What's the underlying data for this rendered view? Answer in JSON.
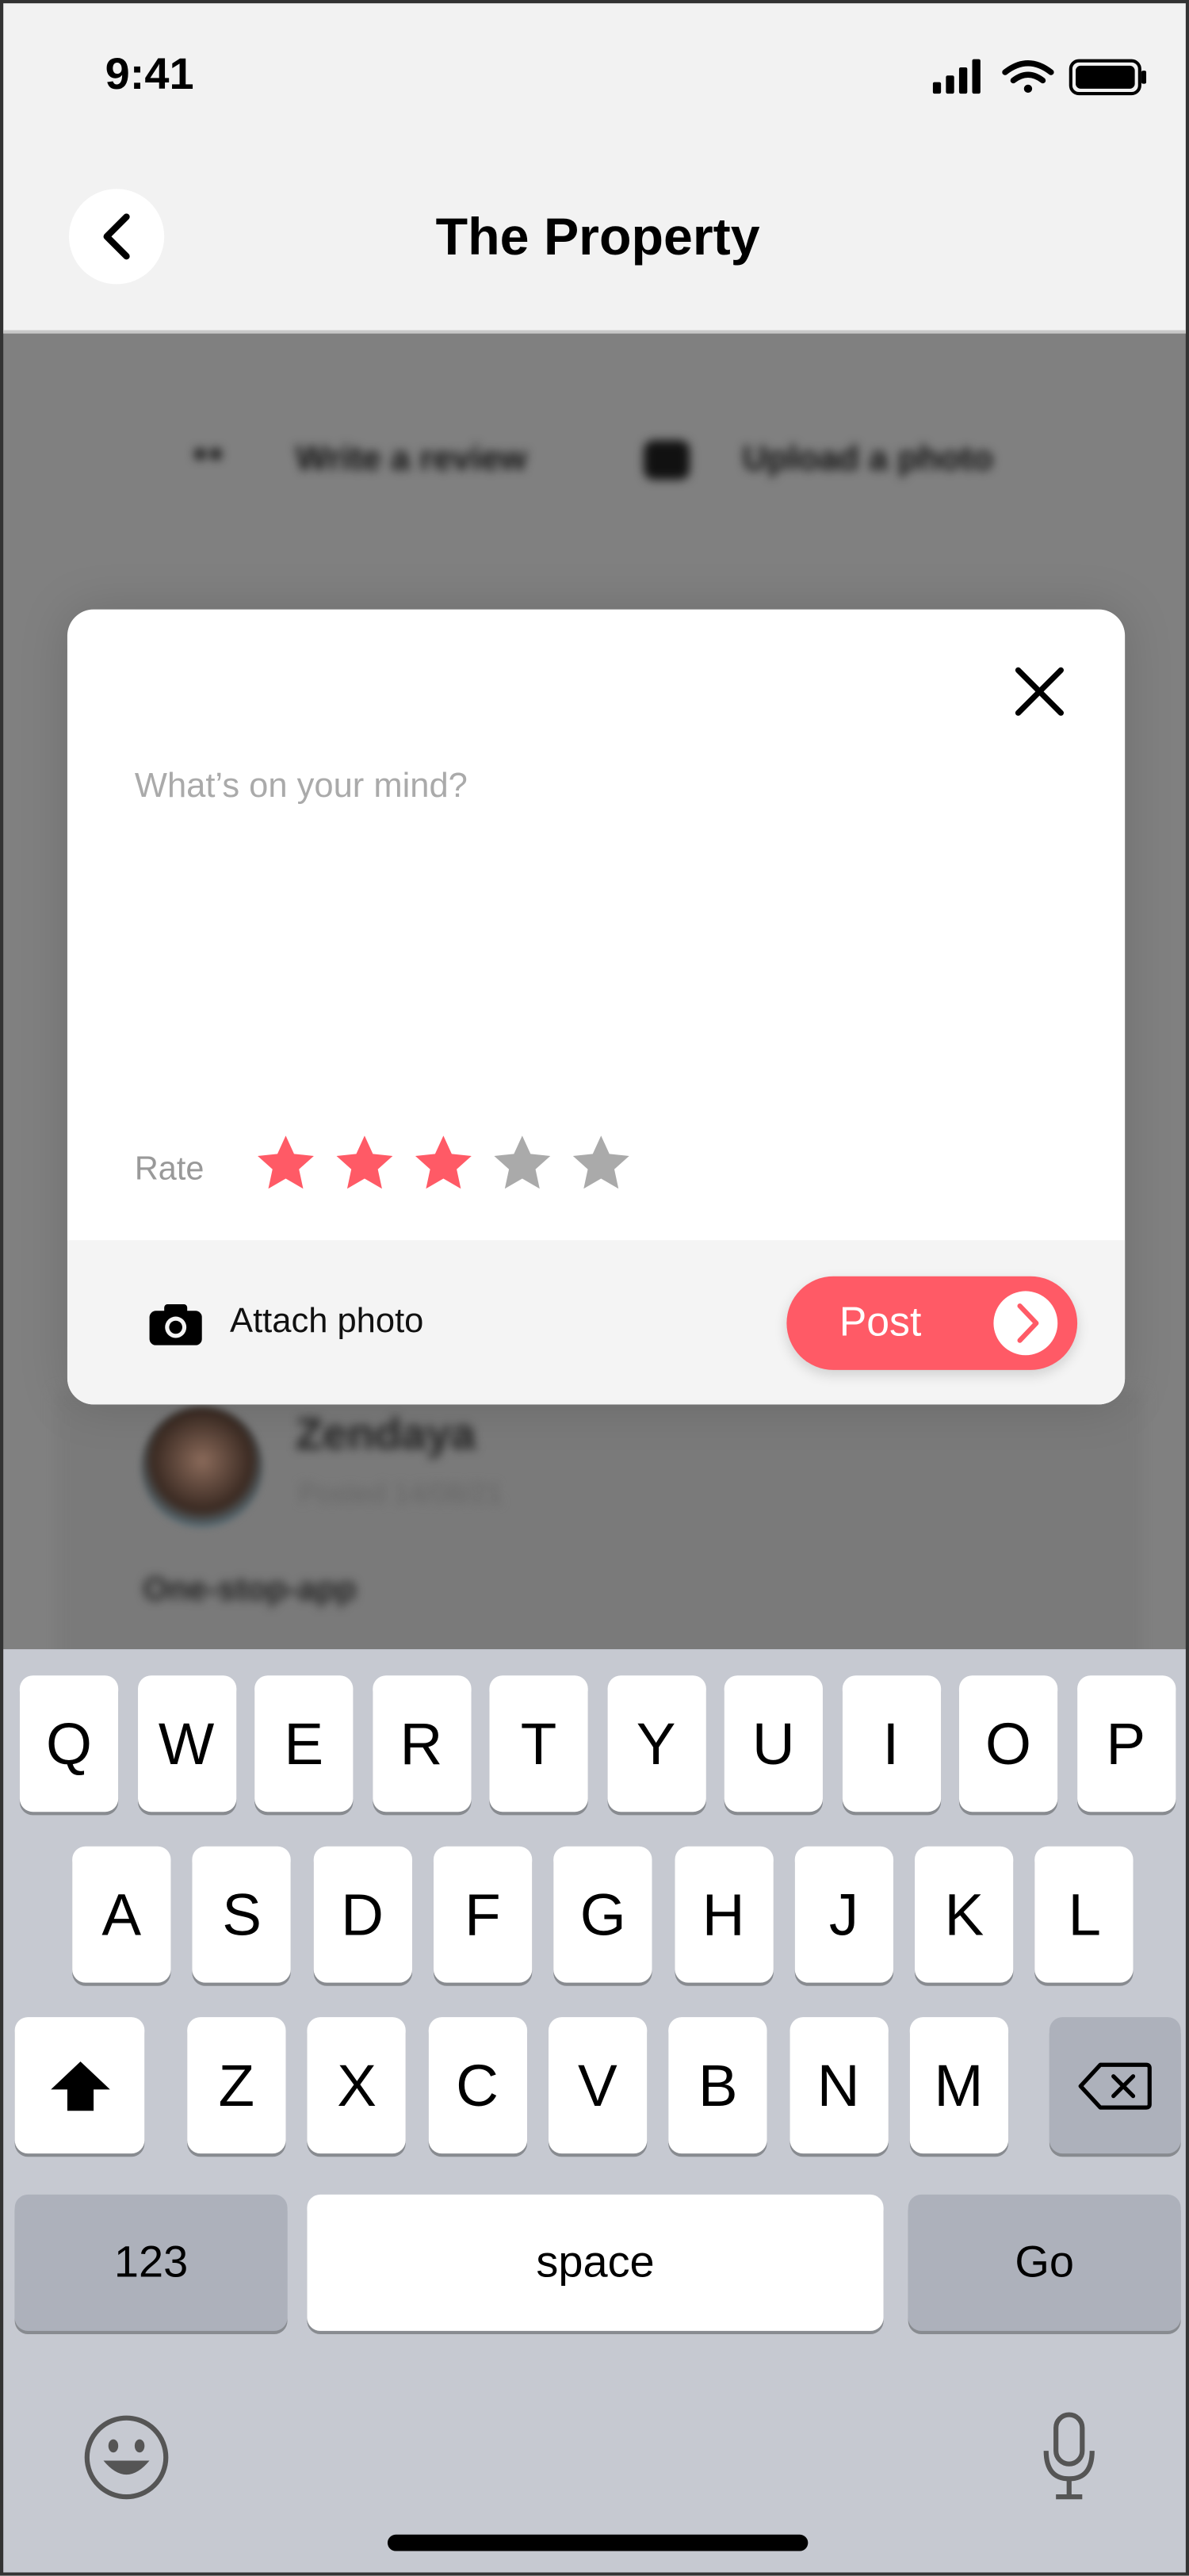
{
  "status_bar": {
    "time": "9:41"
  },
  "header": {
    "title": "The Property",
    "back_icon": "chevron-left-icon"
  },
  "background": {
    "write_review": "Write a review",
    "upload_photo": "Upload a photo",
    "review": {
      "author": "Zendaya",
      "posted": "Posted 14/08/21",
      "text": "One-stop-app"
    }
  },
  "modal": {
    "placeholder": "What’s on your mind?",
    "rate_label": "Rate",
    "rating": 3,
    "max_rating": 5,
    "attach_label": "Attach photo",
    "post_label": "Post",
    "accent": "#ff5a66",
    "star_off": "#aaaaaa"
  },
  "keyboard": {
    "row1": [
      "Q",
      "W",
      "E",
      "R",
      "T",
      "Y",
      "U",
      "I",
      "O",
      "P"
    ],
    "row2": [
      "A",
      "S",
      "D",
      "F",
      "G",
      "H",
      "J",
      "K",
      "L"
    ],
    "row3": [
      "Z",
      "X",
      "C",
      "V",
      "B",
      "N",
      "M"
    ],
    "numbers": "123",
    "space": "space",
    "go": "Go"
  }
}
